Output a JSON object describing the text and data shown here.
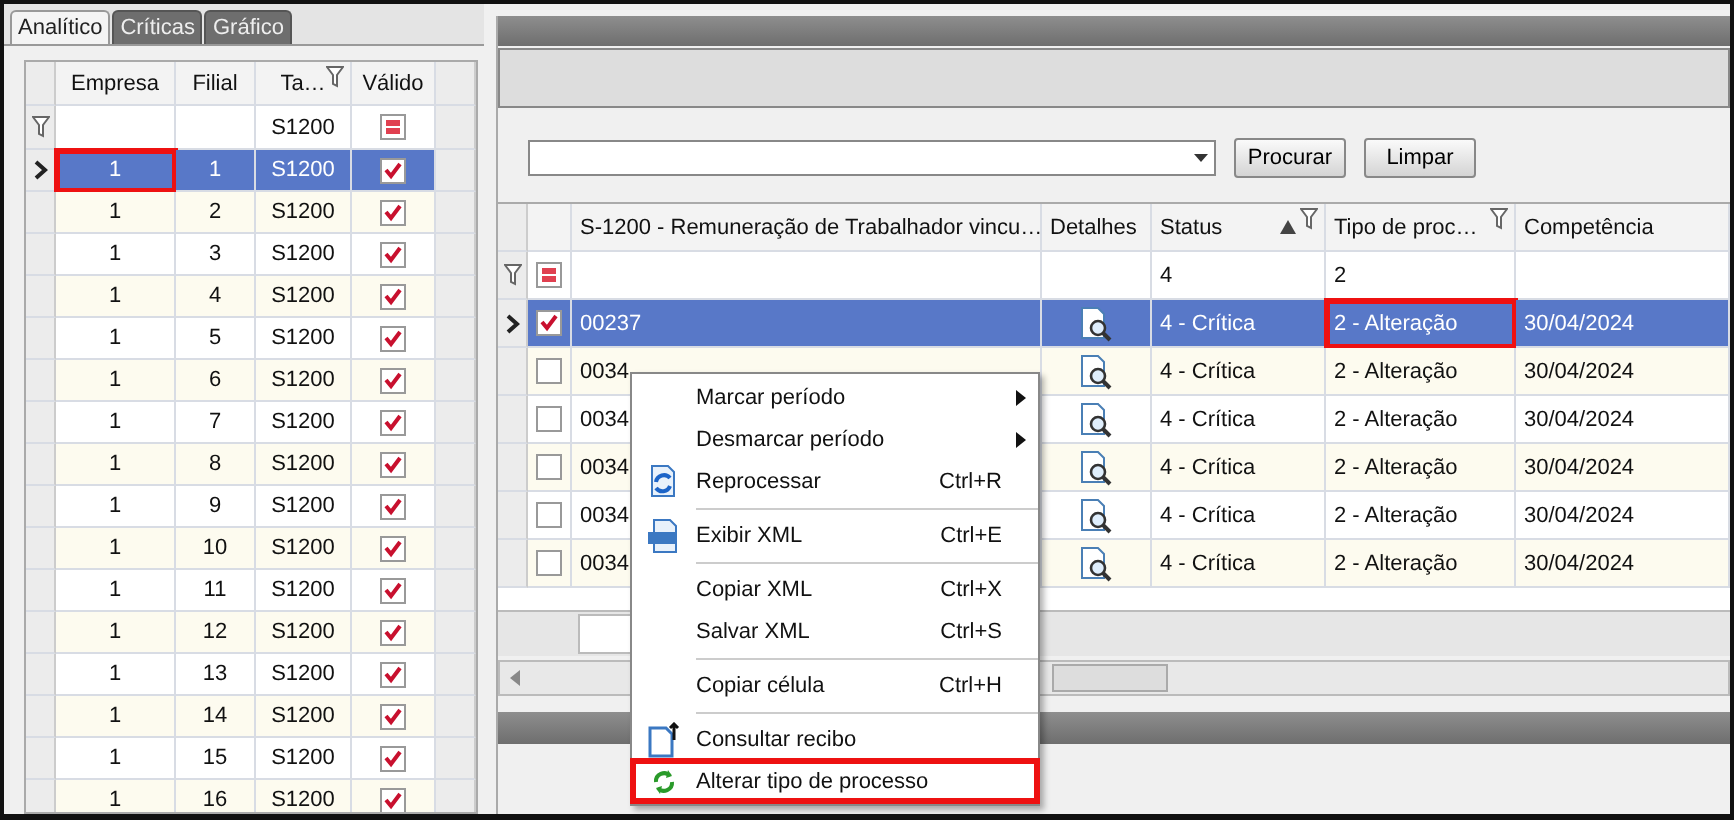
{
  "tabs": [
    {
      "label": "Analítico",
      "selected": true
    },
    {
      "label": "Críticas",
      "selected": false
    },
    {
      "label": "Gráfico",
      "selected": false
    }
  ],
  "left_grid": {
    "columns": [
      {
        "label": "Empresa",
        "filter": false
      },
      {
        "label": "Filial",
        "filter": false
      },
      {
        "label": "Ta…",
        "filter": true
      },
      {
        "label": "Válido",
        "filter": false
      }
    ],
    "filter_row": {
      "tabela": "S1200"
    },
    "rows": [
      {
        "empresa": "1",
        "filial": "1",
        "tabela": "S1200",
        "valido": true,
        "selected": true,
        "highlighted": true
      },
      {
        "empresa": "1",
        "filial": "2",
        "tabela": "S1200",
        "valido": true,
        "selected": false,
        "highlighted": false
      },
      {
        "empresa": "1",
        "filial": "3",
        "tabela": "S1200",
        "valido": true,
        "selected": false,
        "highlighted": false
      },
      {
        "empresa": "1",
        "filial": "4",
        "tabela": "S1200",
        "valido": true,
        "selected": false,
        "highlighted": false
      },
      {
        "empresa": "1",
        "filial": "5",
        "tabela": "S1200",
        "valido": true,
        "selected": false,
        "highlighted": false
      },
      {
        "empresa": "1",
        "filial": "6",
        "tabela": "S1200",
        "valido": true,
        "selected": false,
        "highlighted": false
      },
      {
        "empresa": "1",
        "filial": "7",
        "tabela": "S1200",
        "valido": true,
        "selected": false,
        "highlighted": false
      },
      {
        "empresa": "1",
        "filial": "8",
        "tabela": "S1200",
        "valido": true,
        "selected": false,
        "highlighted": false
      },
      {
        "empresa": "1",
        "filial": "9",
        "tabela": "S1200",
        "valido": true,
        "selected": false,
        "highlighted": false
      },
      {
        "empresa": "1",
        "filial": "10",
        "tabela": "S1200",
        "valido": true,
        "selected": false,
        "highlighted": false
      },
      {
        "empresa": "1",
        "filial": "11",
        "tabela": "S1200",
        "valido": true,
        "selected": false,
        "highlighted": false
      },
      {
        "empresa": "1",
        "filial": "12",
        "tabela": "S1200",
        "valido": true,
        "selected": false,
        "highlighted": false
      },
      {
        "empresa": "1",
        "filial": "13",
        "tabela": "S1200",
        "valido": true,
        "selected": false,
        "highlighted": false
      },
      {
        "empresa": "1",
        "filial": "14",
        "tabela": "S1200",
        "valido": true,
        "selected": false,
        "highlighted": false
      },
      {
        "empresa": "1",
        "filial": "15",
        "tabela": "S1200",
        "valido": true,
        "selected": false,
        "highlighted": false
      },
      {
        "empresa": "1",
        "filial": "16",
        "tabela": "S1200",
        "valido": true,
        "selected": false,
        "highlighted": false
      }
    ]
  },
  "search": {
    "buttons": [
      "Procurar",
      "Limpar"
    ]
  },
  "right_grid": {
    "columns": [
      {
        "label": "S-1200 - Remuneração de Trabalhador vincu…",
        "filter": false,
        "sorted": false
      },
      {
        "label": "Detalhes",
        "filter": false,
        "sorted": false
      },
      {
        "label": "Status",
        "filter": true,
        "sorted": true
      },
      {
        "label": "Tipo de proc…",
        "filter": true,
        "sorted": false
      },
      {
        "label": "Competência",
        "filter": false,
        "sorted": false
      }
    ],
    "filter_row": {
      "status": "4",
      "tipo": "2"
    },
    "rows": [
      {
        "id": "00237",
        "checked": true,
        "status": "4 - Crítica",
        "tipo": "2 - Alteração",
        "competencia": "30/04/2024",
        "selected": true,
        "highlighted": true
      },
      {
        "id": "0034",
        "checked": false,
        "status": "4 - Crítica",
        "tipo": "2 - Alteração",
        "competencia": "30/04/2024",
        "selected": false,
        "highlighted": false
      },
      {
        "id": "0034",
        "checked": false,
        "status": "4 - Crítica",
        "tipo": "2 - Alteração",
        "competencia": "30/04/2024",
        "selected": false,
        "highlighted": false
      },
      {
        "id": "0034",
        "checked": false,
        "status": "4 - Crítica",
        "tipo": "2 - Alteração",
        "competencia": "30/04/2024",
        "selected": false,
        "highlighted": false
      },
      {
        "id": "0034",
        "checked": false,
        "status": "4 - Crítica",
        "tipo": "2 - Alteração",
        "competencia": "30/04/2024",
        "selected": false,
        "highlighted": false
      },
      {
        "id": "0034",
        "checked": false,
        "status": "4 - Crítica",
        "tipo": "2 - Alteração",
        "competencia": "30/04/2024",
        "selected": false,
        "highlighted": false
      }
    ]
  },
  "context_menu": {
    "items": [
      {
        "kind": "submenu",
        "label": "Marcar período",
        "highlighted": false
      },
      {
        "kind": "submenu",
        "label": "Desmarcar período",
        "highlighted": false
      },
      {
        "kind": "reprocess",
        "label": "Reprocessar",
        "shortcut": "Ctrl+R",
        "highlighted": false
      },
      {
        "kind": "separator"
      },
      {
        "kind": "xml",
        "label": "Exibir XML",
        "shortcut": "Ctrl+E",
        "highlighted": false
      },
      {
        "kind": "separator"
      },
      {
        "kind": "plain",
        "label": "Copiar XML",
        "shortcut": "Ctrl+X",
        "highlighted": false
      },
      {
        "kind": "plain",
        "label": "Salvar XML",
        "shortcut": "Ctrl+S",
        "highlighted": false
      },
      {
        "kind": "separator"
      },
      {
        "kind": "plain",
        "label": "Copiar célula",
        "shortcut": "Ctrl+H",
        "highlighted": false
      },
      {
        "kind": "separator"
      },
      {
        "kind": "receipt",
        "label": "Consultar recibo",
        "highlighted": false
      },
      {
        "kind": "cycle",
        "label": "Alterar tipo de processo",
        "highlighted": true
      }
    ]
  }
}
